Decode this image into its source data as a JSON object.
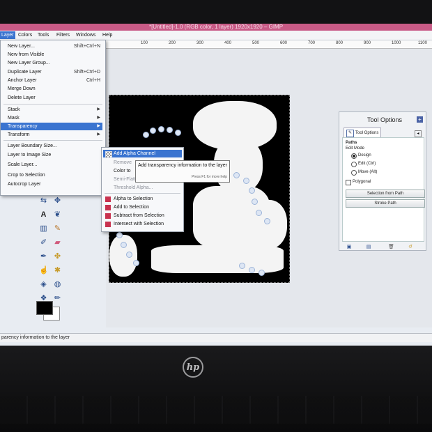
{
  "window": {
    "title": "*[Untitled]-1.0 (RGB color, 1 layer) 1920x1920 – GIMP"
  },
  "menubar": {
    "items": [
      {
        "label": "Layer"
      },
      {
        "label": "Colors"
      },
      {
        "label": "Tools"
      },
      {
        "label": "Filters"
      },
      {
        "label": "Windows"
      },
      {
        "label": "Help"
      }
    ]
  },
  "ruler": {
    "ticks": [
      "100",
      "200",
      "300",
      "400",
      "500",
      "600",
      "700",
      "800",
      "900",
      "1000",
      "1100"
    ]
  },
  "layer_menu": {
    "items": [
      {
        "label": "New Layer...",
        "shortcut": "Shift+Ctrl+N"
      },
      {
        "label": "New from Visible"
      },
      {
        "label": "New Layer Group..."
      },
      {
        "label": "Duplicate Layer",
        "shortcut": "Shift+Ctrl+D"
      },
      {
        "label": "Anchor Layer",
        "shortcut": "Ctrl+H"
      },
      {
        "label": "Merge Down"
      },
      {
        "label": "Delete Layer"
      },
      {
        "label": "Stack"
      },
      {
        "label": "Mask"
      },
      {
        "label": "Transparency"
      },
      {
        "label": "Transform"
      },
      {
        "label": "Layer Boundary Size..."
      },
      {
        "label": "Layer to Image Size"
      },
      {
        "label": "Scale Layer..."
      },
      {
        "label": "Crop to Selection"
      },
      {
        "label": "Autocrop Layer"
      }
    ]
  },
  "transparency_submenu": {
    "items": [
      {
        "label": "Add Alpha Channel"
      },
      {
        "label": "Remove"
      },
      {
        "label": "Color to"
      },
      {
        "label": "Semi-Flatten..."
      },
      {
        "label": "Threshold Alpha..."
      },
      {
        "label": "Alpha to Selection"
      },
      {
        "label": "Add to Selection"
      },
      {
        "label": "Subtract from Selection"
      },
      {
        "label": "Intersect with Selection"
      }
    ]
  },
  "tooltip": {
    "text": "Add transparency information to the layer",
    "hint": "Press F1 for more help"
  },
  "tool_options": {
    "title": "Tool Options",
    "tab_label": "Tool Options",
    "section": "Paths",
    "edit_mode_label": "Edit Mode",
    "modes": [
      "Design",
      "Edit (Ctrl)",
      "Move (Alt)"
    ],
    "selected_mode": "Design",
    "polygonal_label": "Polygonal",
    "polygonal_checked": false,
    "buttons": [
      "Selection from Path",
      "Stroke Path"
    ]
  },
  "statusbar": {
    "text": "parency information to the layer"
  },
  "bezel": {
    "logo": "hp"
  },
  "colors": {
    "accent": "#3a74d0",
    "titlebar": "#c85a86",
    "foreground": "#000000",
    "background": "#ffffff"
  }
}
